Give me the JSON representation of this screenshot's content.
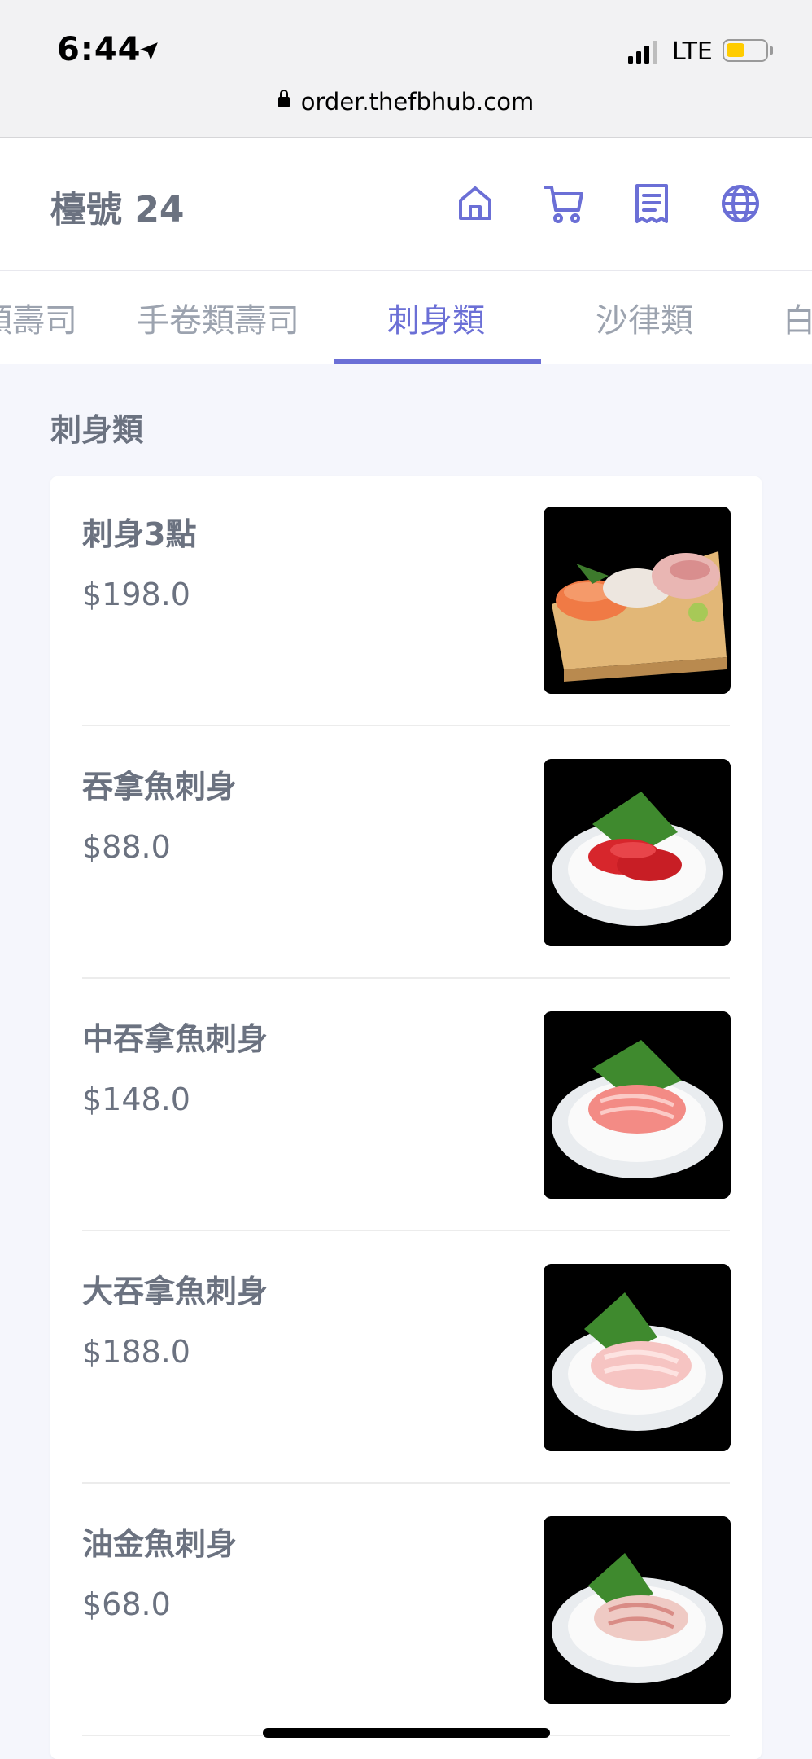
{
  "status_bar": {
    "time": "6:44",
    "network": "LTE",
    "url": "order.thefbhub.com"
  },
  "header": {
    "table_label": "檯號 24",
    "icons": [
      "home-icon",
      "cart-icon",
      "receipt-icon",
      "globe-icon"
    ],
    "accent_color": "#6b6fd6"
  },
  "tabs": [
    {
      "label": "類壽司"
    },
    {
      "label": "手卷類壽司"
    },
    {
      "label": "刺身類",
      "active": true
    },
    {
      "label": "沙律類"
    },
    {
      "label": "白"
    }
  ],
  "section": {
    "title": "刺身類"
  },
  "items": [
    {
      "name": "刺身3點",
      "price": "$198.0"
    },
    {
      "name": "吞拿魚刺身",
      "price": "$88.0"
    },
    {
      "name": "中吞拿魚刺身",
      "price": "$148.0"
    },
    {
      "name": "大吞拿魚刺身",
      "price": "$188.0"
    },
    {
      "name": "油金魚刺身",
      "price": "$68.0"
    }
  ]
}
